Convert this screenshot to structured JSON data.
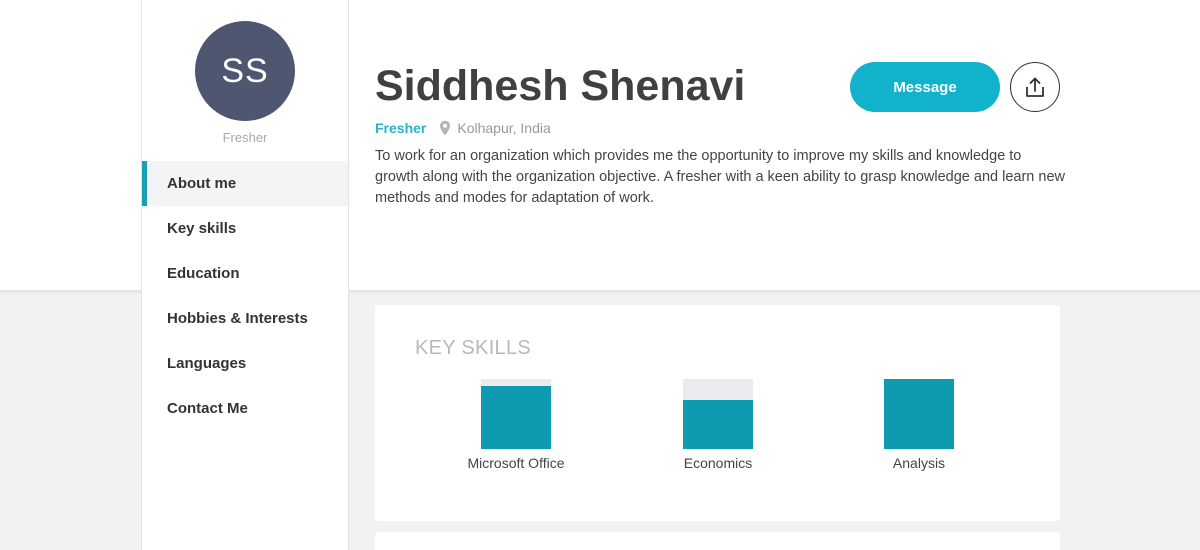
{
  "profile": {
    "initials": "SS",
    "role": "Fresher",
    "name": "Siddhesh Shenavi",
    "location": "Kolhapur, India",
    "about": "To work for an organization which provides me the opportunity to improve my skills and knowledge to growth along with the organization objective. A fresher with a keen ability to grasp knowledge and learn new methods and modes for adaptation of work."
  },
  "sidebar": {
    "items": [
      {
        "label": "About me",
        "active": true
      },
      {
        "label": "Key skills"
      },
      {
        "label": "Education"
      },
      {
        "label": "Hobbies & Interests"
      },
      {
        "label": "Languages"
      },
      {
        "label": "Contact Me"
      }
    ]
  },
  "actions": {
    "message_label": "Message",
    "share_icon": "share-upload-icon"
  },
  "key_skills": {
    "title": "KEY SKILLS",
    "skills": [
      {
        "label": "Microsoft Office",
        "level": 0.9
      },
      {
        "label": "Economics",
        "level": 0.7
      },
      {
        "label": "Analysis",
        "level": 1.0
      }
    ]
  },
  "colors": {
    "accent": "#13b2cc",
    "skill_fill": "#0e9bb0",
    "avatar_bg": "#4e5670"
  }
}
